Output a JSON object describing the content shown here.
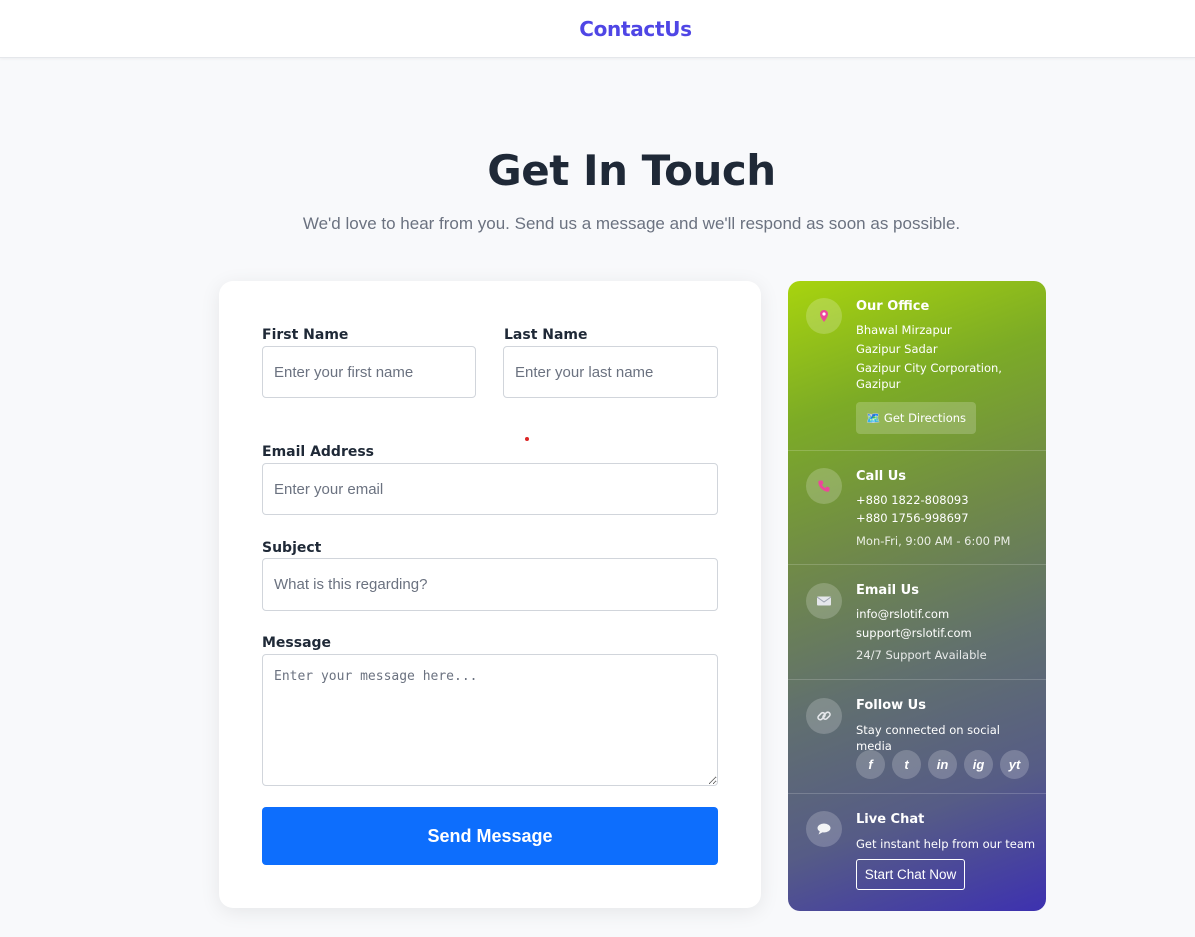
{
  "header": {
    "brand": "ContactUs"
  },
  "hero": {
    "title": "Get In Touch",
    "subtitle": "We'd love to hear from you. Send us a message and we'll respond as soon as possible."
  },
  "form": {
    "first_name_label": "First Name",
    "first_name_placeholder": "Enter your first name",
    "last_name_label": "Last Name",
    "last_name_placeholder": "Enter your last name",
    "email_label": "Email Address",
    "email_placeholder": "Enter your email",
    "subject_label": "Subject",
    "subject_placeholder": "What is this regarding?",
    "message_label": "Message",
    "message_placeholder": "Enter your message here...",
    "submit_label": "Send Message"
  },
  "info": {
    "office": {
      "icon": "map-pin-icon",
      "title": "Our Office",
      "line1": "Bhawal Mirzapur",
      "line2": "Gazipur Sadar",
      "line3": "Gazipur City Corporation, Gazipur",
      "button": "🗺️ Get Directions"
    },
    "call": {
      "icon": "phone-icon",
      "title": "Call Us",
      "phone1": "+880 1822-808093",
      "phone2": "+880 1756-998697",
      "hours": "Mon-Fri, 9:00 AM - 6:00 PM"
    },
    "email": {
      "icon": "envelope-icon",
      "title": "Email Us",
      "email1": "info@rslotif.com",
      "email2": "support@rslotif.com",
      "note": "24/7 Support Available"
    },
    "follow": {
      "icon": "link-icon",
      "title": "Follow Us",
      "text": "Stay connected on social media",
      "socials": [
        "f",
        "t",
        "in",
        "ig",
        "yt"
      ]
    },
    "chat": {
      "icon": "speech-bubble-icon",
      "title": "Live Chat",
      "text": "Get instant help from our team",
      "button": "Start Chat Now"
    }
  },
  "colors": {
    "brand": "#4f46e5",
    "submit": "#0d6efd",
    "gradient_start": "#a8d40e",
    "gradient_end": "#3d31b0"
  }
}
